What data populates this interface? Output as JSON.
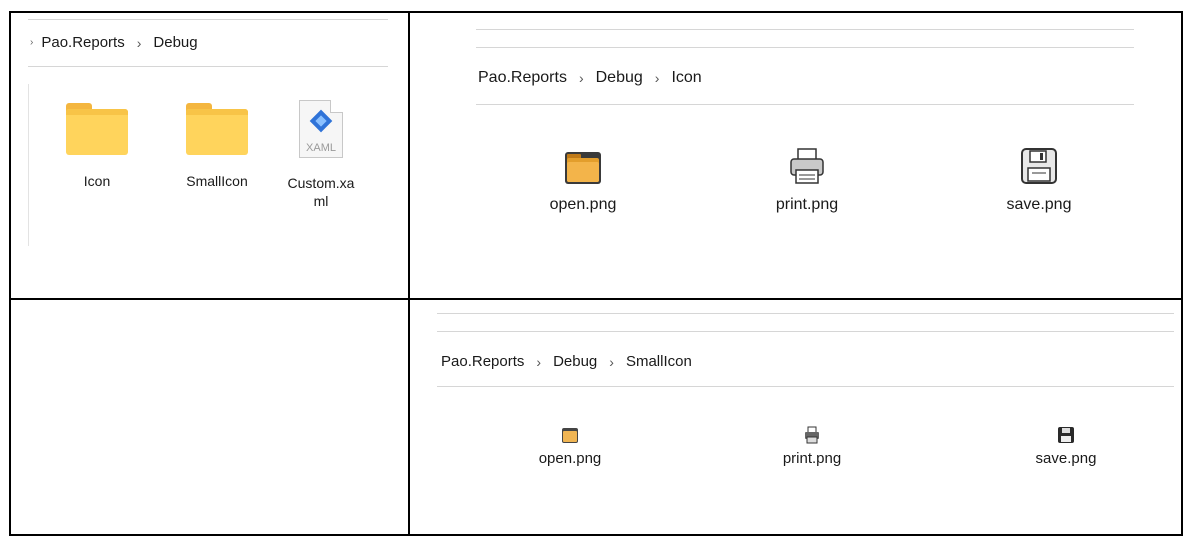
{
  "left_panel": {
    "breadcrumb": {
      "lead": "›",
      "parts": [
        "Pao.Reports",
        "Debug"
      ]
    },
    "items": [
      {
        "label": "Icon",
        "icon": "folder-icon"
      },
      {
        "label": "SmallIcon",
        "icon": "folder-icon"
      },
      {
        "label_line1": "Custom.xa",
        "label_line2": "ml",
        "icon": "xaml-file-icon",
        "icon_text": "XAML"
      }
    ]
  },
  "top_right_panel": {
    "breadcrumb": {
      "parts": [
        "Pao.Reports",
        "Debug",
        "Icon"
      ]
    },
    "items": [
      {
        "label": "open.png",
        "icon": "open-folder-icon"
      },
      {
        "label": "print.png",
        "icon": "printer-icon"
      },
      {
        "label": "save.png",
        "icon": "floppy-disk-icon"
      }
    ]
  },
  "bottom_right_panel": {
    "breadcrumb": {
      "parts": [
        "Pao.Reports",
        "Debug",
        "SmallIcon"
      ]
    },
    "items": [
      {
        "label": "open.png",
        "icon": "open-folder-icon"
      },
      {
        "label": "print.png",
        "icon": "printer-icon"
      },
      {
        "label": "save.png",
        "icon": "floppy-disk-icon"
      }
    ]
  },
  "separator": "›",
  "colors": {
    "folder": "#ffd45c",
    "folder_tab": "#f4b63f",
    "xaml_blue": "#2f73d8",
    "border": "#000000"
  }
}
